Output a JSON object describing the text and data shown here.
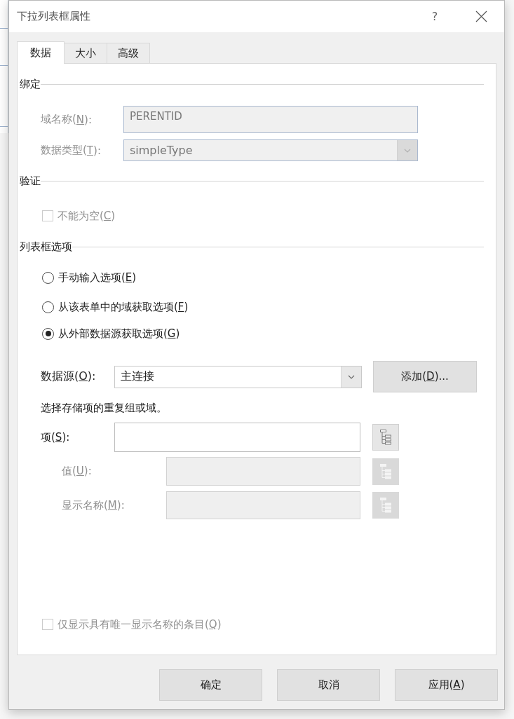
{
  "window": {
    "title": "下拉列表框属性",
    "help": "?"
  },
  "tabs": [
    {
      "label": "数据",
      "selected": true
    },
    {
      "label": "大小",
      "selected": false
    },
    {
      "label": "高级",
      "selected": false
    }
  ],
  "binding": {
    "title": "绑定",
    "fields": [
      {
        "kind": "text",
        "label": "域名称(",
        "access_key": "N",
        "label_end": "):",
        "value": "PERENTID",
        "disabled": true
      },
      {
        "kind": "combo",
        "label": "数据类型(",
        "access_key": "T",
        "label_end": "):",
        "value": "simpleType",
        "disabled": true
      }
    ]
  },
  "validation": {
    "title": "验证",
    "options": [
      {
        "label": "不能为空(",
        "access_key": "C",
        "label_end": ")",
        "checked": false,
        "disabled": true
      }
    ]
  },
  "list_options": {
    "title": "列表框选项",
    "choices": [
      {
        "label": "手动输入选项(",
        "access_key": "E",
        "label_end": ")",
        "selected": false
      },
      {
        "label": "从该表单中的域获取选项(",
        "access_key": "F",
        "label_end": ")",
        "selected": false
      },
      {
        "label": "从外部数据源获取选项(",
        "access_key": "G",
        "label_end": ")",
        "selected": true
      }
    ],
    "data_source": {
      "label": "数据源(",
      "access_key": "O",
      "label_end": "):",
      "value": "主连接",
      "button": {
        "label": "添加(",
        "access_key": "D",
        "label_end": ")..."
      }
    },
    "hint": "选择存储项的重复组或域。",
    "item_field": {
      "label": "项(",
      "access_key": "S",
      "label_end": "):",
      "disabled": false,
      "children": [
        {
          "label": "值(",
          "access_key": "U",
          "label_end": "):",
          "disabled": true
        },
        {
          "label": "显示名称(",
          "access_key": "M",
          "label_end": "):",
          "disabled": true
        }
      ]
    },
    "unique_only": {
      "label": "仅显示具有唯一显示名称的条目(",
      "access_key": "Q",
      "label_end": ")",
      "checked": false,
      "disabled": true
    }
  },
  "buttons": [
    {
      "label": "确定"
    },
    {
      "label": "取消"
    },
    {
      "label": "应用(",
      "access_key": "A",
      "label_end": ")"
    }
  ]
}
